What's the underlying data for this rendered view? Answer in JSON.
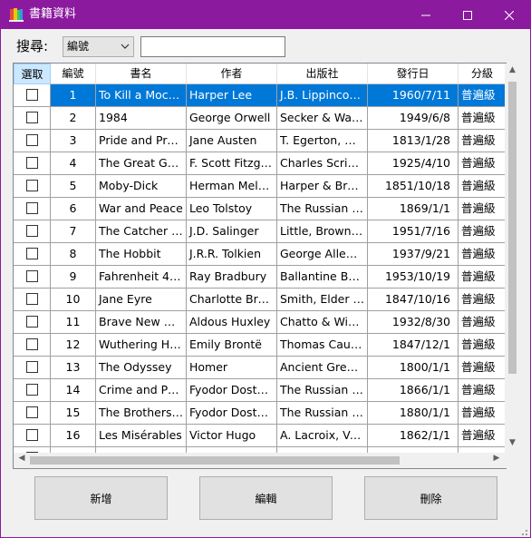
{
  "window": {
    "title": "書籍資料",
    "accent_color": "#8b1a9f",
    "icon": "books-app-icon"
  },
  "search": {
    "label": "搜尋:",
    "field_selected": "編號",
    "input_value": "",
    "input_placeholder": ""
  },
  "grid": {
    "columns": [
      "選取",
      "編號",
      "書名",
      "作者",
      "出版社",
      "發行日",
      "分級"
    ],
    "selected_row_color": "#0078d7",
    "rows": [
      {
        "checked": false,
        "id": "1",
        "title": "To Kill a Mocki...",
        "author": "Harper Lee",
        "publisher": "J.B. Lippincott ...",
        "date": "1960/7/11",
        "category": "普遍級"
      },
      {
        "checked": false,
        "id": "2",
        "title": "1984",
        "author": "George Orwell",
        "publisher": "Secker & War...",
        "date": "1949/6/8",
        "category": "普遍級"
      },
      {
        "checked": false,
        "id": "3",
        "title": "Pride and Prej...",
        "author": "Jane Austen",
        "publisher": "T. Egerton, Wh...",
        "date": "1813/1/28",
        "category": "普遍級"
      },
      {
        "checked": false,
        "id": "4",
        "title": "The Great Gats...",
        "author": "F. Scott Fitzger...",
        "publisher": "Charles Scribn...",
        "date": "1925/4/10",
        "category": "普遍級"
      },
      {
        "checked": false,
        "id": "5",
        "title": "Moby-Dick",
        "author": "Herman Melville",
        "publisher": "Harper & Brot...",
        "date": "1851/10/18",
        "category": "普遍級"
      },
      {
        "checked": false,
        "id": "6",
        "title": "War and Peace",
        "author": "Leo Tolstoy",
        "publisher": "The Russian M...",
        "date": "1869/1/1",
        "category": "普遍級"
      },
      {
        "checked": false,
        "id": "7",
        "title": "The Catcher in ...",
        "author": "J.D. Salinger",
        "publisher": "Little, Brown a...",
        "date": "1951/7/16",
        "category": "普遍級"
      },
      {
        "checked": false,
        "id": "8",
        "title": "The Hobbit",
        "author": "J.R.R. Tolkien",
        "publisher": "George Allen ...",
        "date": "1937/9/21",
        "category": "普遍級"
      },
      {
        "checked": false,
        "id": "9",
        "title": "Fahrenheit 451",
        "author": "Ray Bradbury",
        "publisher": "Ballantine Books",
        "date": "1953/10/19",
        "category": "普遍級"
      },
      {
        "checked": false,
        "id": "10",
        "title": "Jane Eyre",
        "author": "Charlotte Brontë",
        "publisher": "Smith, Elder & ...",
        "date": "1847/10/16",
        "category": "普遍級"
      },
      {
        "checked": false,
        "id": "11",
        "title": "Brave New Wo...",
        "author": "Aldous Huxley",
        "publisher": "Chatto & Win...",
        "date": "1932/8/30",
        "category": "普遍級"
      },
      {
        "checked": false,
        "id": "12",
        "title": "Wuthering Hei...",
        "author": "Emily Brontë",
        "publisher": "Thomas Cautl...",
        "date": "1847/12/1",
        "category": "普遍級"
      },
      {
        "checked": false,
        "id": "13",
        "title": "The Odyssey",
        "author": "Homer",
        "publisher": "Ancient Greece",
        "date": "1800/1/1",
        "category": "普遍級"
      },
      {
        "checked": false,
        "id": "14",
        "title": "Crime and Pun...",
        "author": "Fyodor Dosto...",
        "publisher": "The Russian M...",
        "date": "1866/1/1",
        "category": "普遍級"
      },
      {
        "checked": false,
        "id": "15",
        "title": "The Brothers K...",
        "author": "Fyodor Dosto...",
        "publisher": "The Russian M...",
        "date": "1880/1/1",
        "category": "普遍級"
      },
      {
        "checked": false,
        "id": "16",
        "title": "Les Misérables",
        "author": "Victor Hugo",
        "publisher": "A. Lacroix, Ver...",
        "date": "1862/1/1",
        "category": "普遍級"
      },
      {
        "checked": false,
        "id": "",
        "title": "",
        "author": "",
        "publisher": "",
        "date": "",
        "category": ""
      }
    ]
  },
  "buttons": {
    "add": "新增",
    "edit": "編輯",
    "delete": "刪除"
  }
}
